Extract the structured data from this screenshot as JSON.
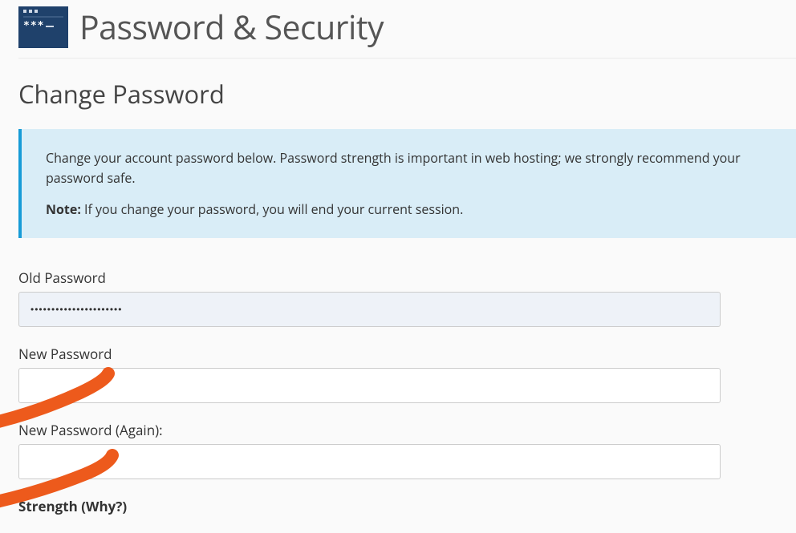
{
  "header": {
    "icon_name": "password-icon",
    "title": "Password & Security"
  },
  "section": {
    "title": "Change Password"
  },
  "alert": {
    "line1": "Change your account password below. Password strength is important in web hosting; we strongly recommend your password safe.",
    "note_label": "Note:",
    "note_text": " If you change your password, you will end your current session."
  },
  "form": {
    "old_password_label": "Old Password",
    "old_password_value": "••••••••••••••••••••••",
    "new_password_label": "New Password",
    "new_password_value": "",
    "new_password_again_label": "New Password (Again):",
    "new_password_again_value": "",
    "strength_label": "Strength (Why?)"
  }
}
